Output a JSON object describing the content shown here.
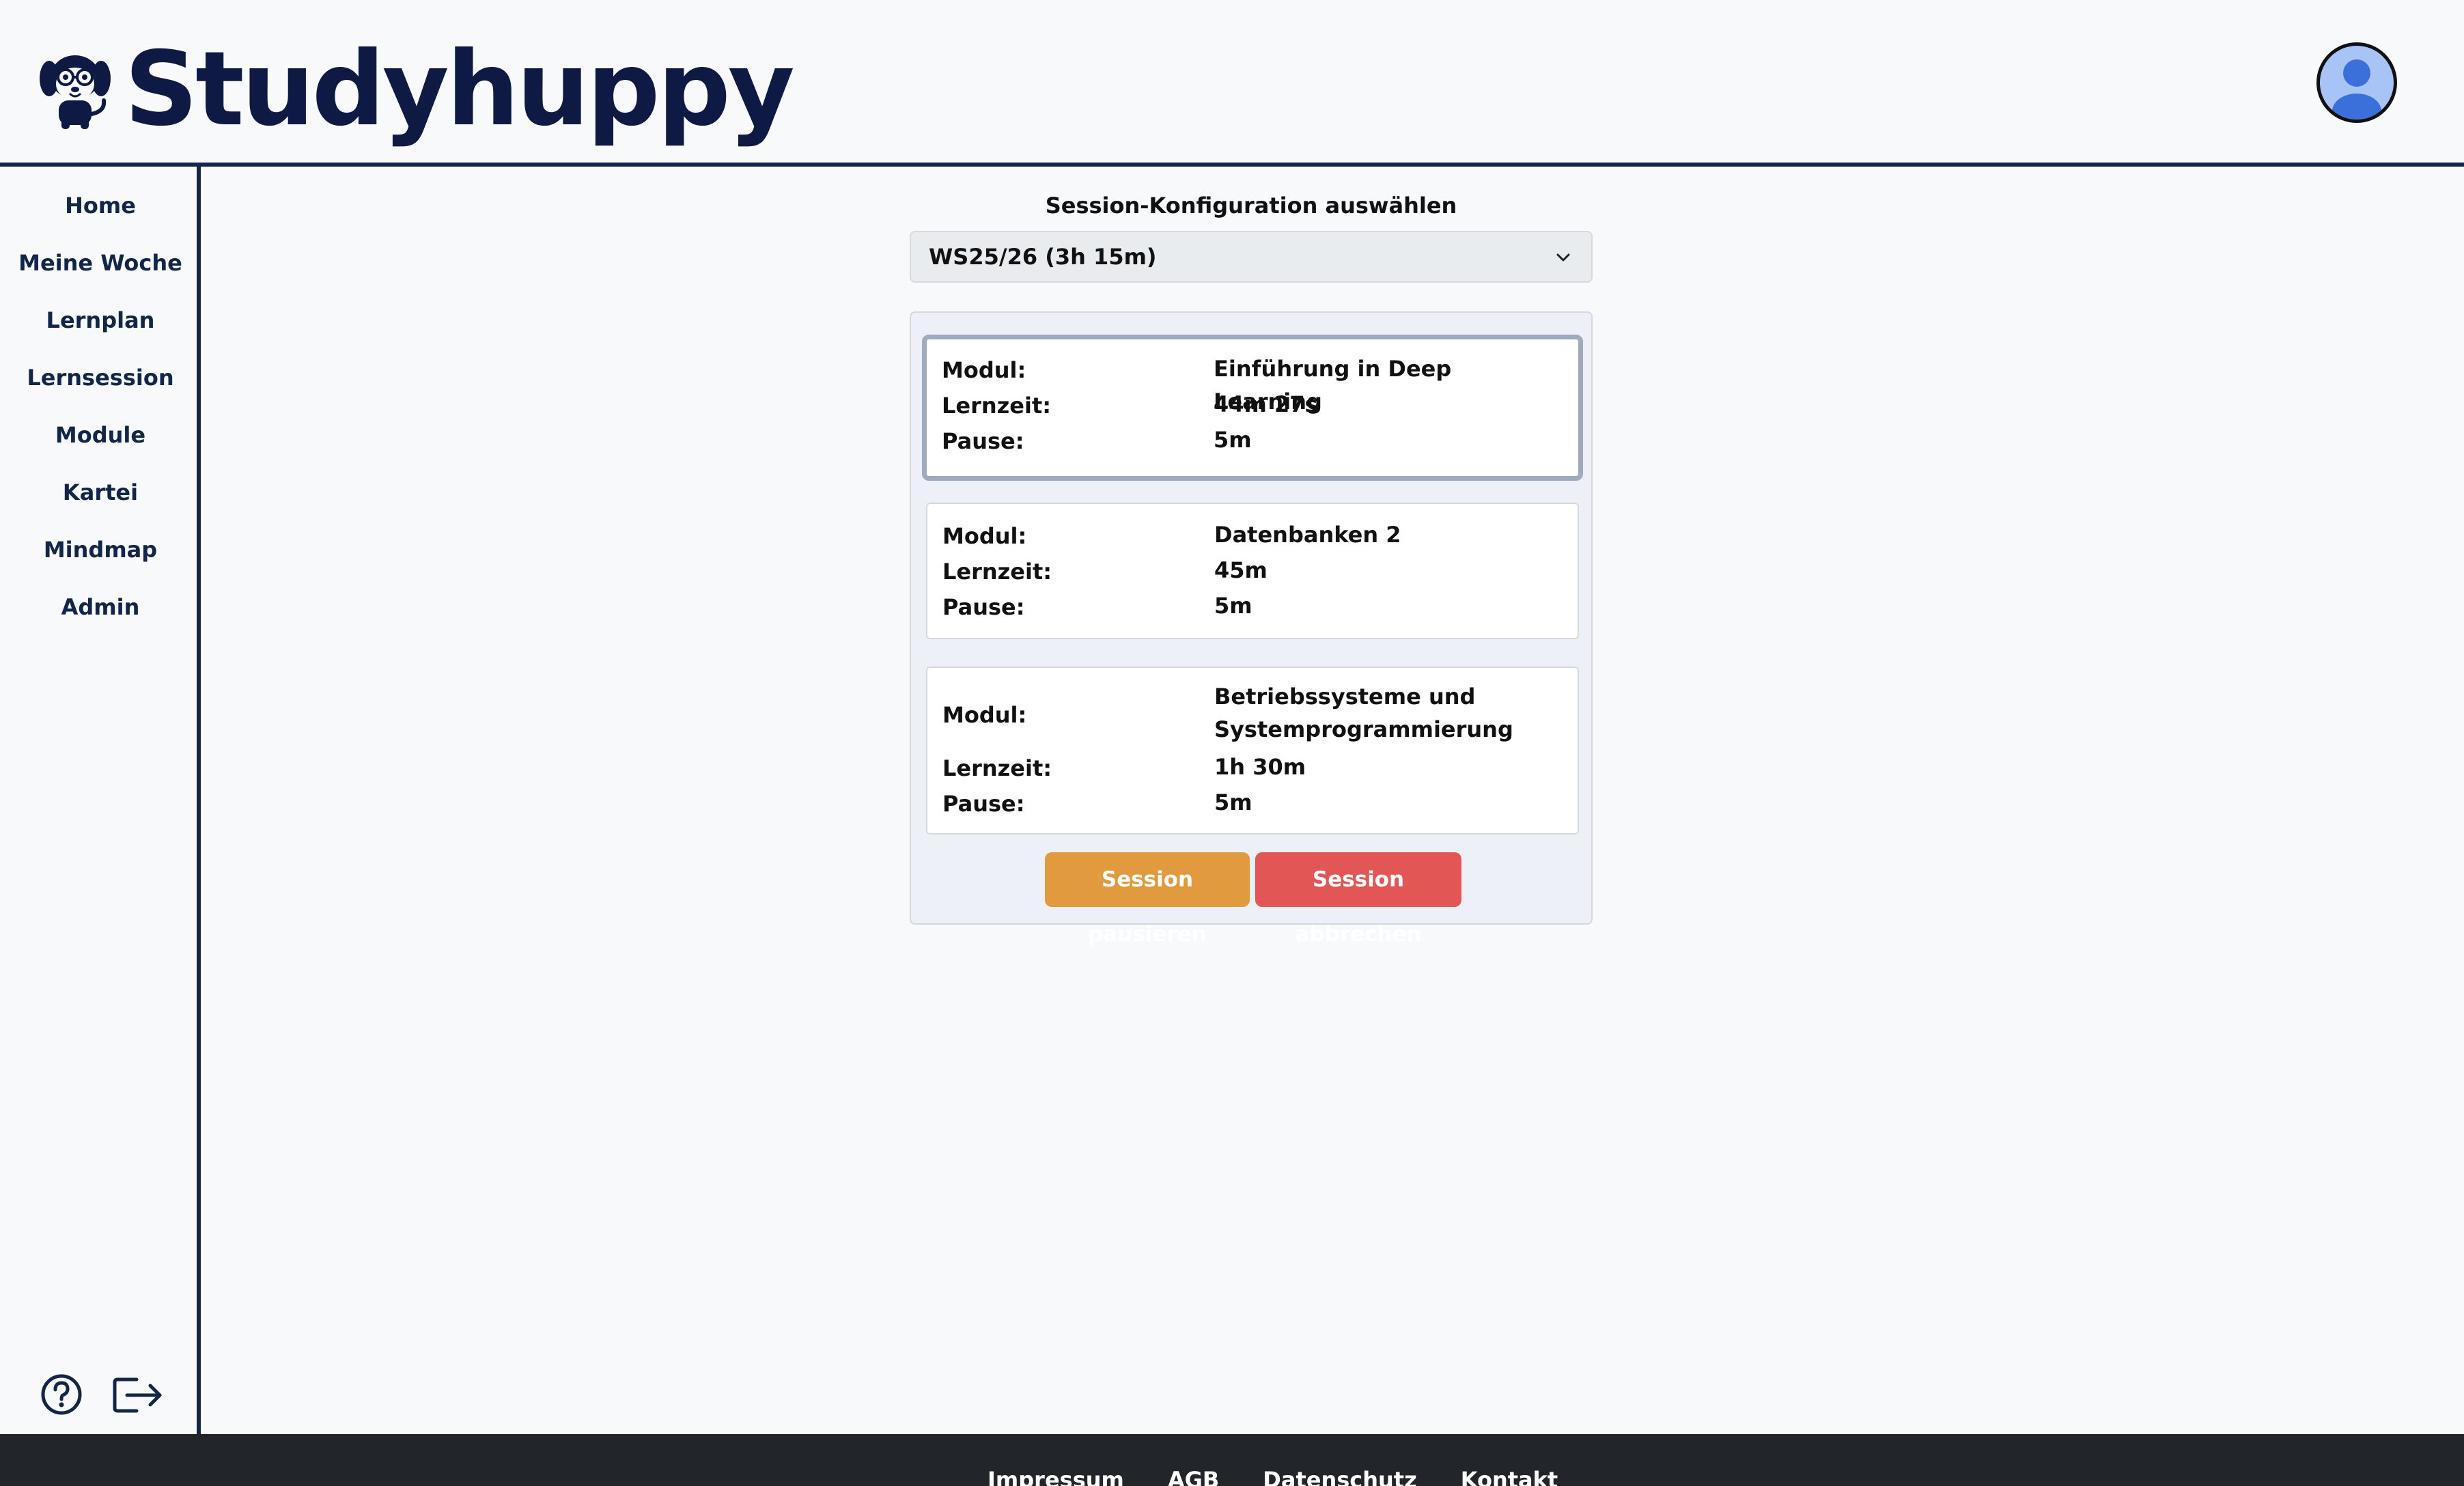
{
  "header": {
    "brand": "Studyhuppy",
    "logo_icon": "dog-with-glasses-icon",
    "avatar_icon": "user-avatar-icon"
  },
  "sidebar": {
    "items": [
      {
        "label": "Home"
      },
      {
        "label": "Meine Woche"
      },
      {
        "label": "Lernplan"
      },
      {
        "label": "Lernsession"
      },
      {
        "label": "Module"
      },
      {
        "label": "Kartei"
      },
      {
        "label": "Mindmap"
      },
      {
        "label": "Admin"
      }
    ],
    "help_icon": "help-circle-icon",
    "logout_icon": "logout-icon"
  },
  "main": {
    "config_label": "Session-Konfiguration auswählen",
    "selected_config": "WS25/26 (3h 15m)",
    "modules": [
      {
        "modul_key": "Modul:",
        "modul": "Einführung in Deep Learning",
        "lernzeit_key": "Lernzeit:",
        "lernzeit": "44m 27s",
        "pause_key": "Pause:",
        "pause": "5m",
        "active": true
      },
      {
        "modul_key": "Modul:",
        "modul": "Datenbanken 2",
        "lernzeit_key": "Lernzeit:",
        "lernzeit": "45m",
        "pause_key": "Pause:",
        "pause": "5m",
        "active": false
      },
      {
        "modul_key": "Modul:",
        "modul": "Betriebssysteme und Systemprogrammierung",
        "lernzeit_key": "Lernzeit:",
        "lernzeit": "1h 30m",
        "pause_key": "Pause:",
        "pause": "5m",
        "active": false
      }
    ],
    "pause_button": "Session pausieren",
    "abort_button": "Session abbrechen"
  },
  "footer": {
    "links": [
      "Impressum",
      "AGB",
      "Datenschutz",
      "Kontakt"
    ]
  },
  "colors": {
    "brand_navy": "#0f1a44",
    "pause_orange": "#e29a3f",
    "abort_red": "#e35656",
    "footer_bg": "#222529"
  }
}
